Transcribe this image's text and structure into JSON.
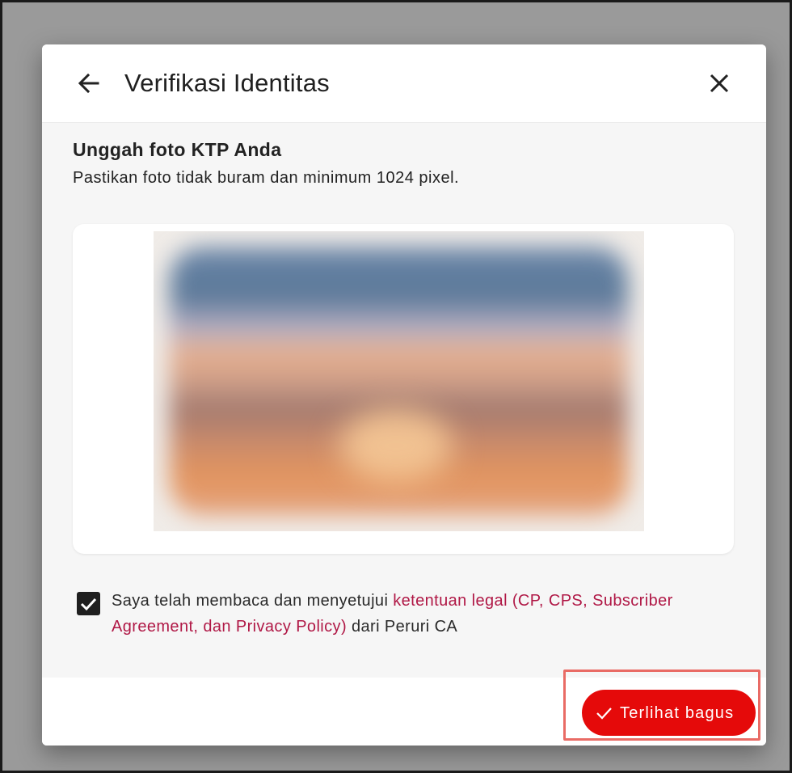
{
  "dialog": {
    "title": "Verifikasi Identitas",
    "back_icon": "arrow-left-icon",
    "close_icon": "close-icon"
  },
  "upload": {
    "title": "Unggah foto KTP Anda",
    "subtitle": "Pastikan foto tidak buram dan minimum 1024 pixel."
  },
  "consent": {
    "checked": true,
    "text_before": "Saya telah membaca dan menyetujui ",
    "link_text": "ketentuan legal (CP, CPS, Subscriber Agreement, dan Privacy Policy)",
    "text_after": " dari Peruri CA",
    "link_color": "#b01846"
  },
  "actions": {
    "primary_label": "Terlihat bagus",
    "primary_icon": "check-icon",
    "primary_color": "#e50a0a"
  }
}
